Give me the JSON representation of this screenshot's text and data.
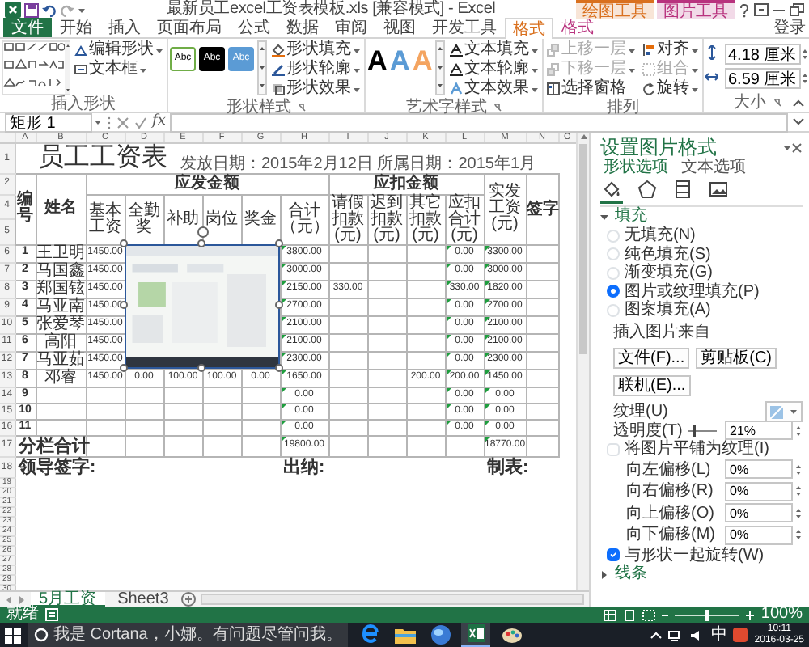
{
  "window": {
    "title": "最新员工excel工资表模板.xls [兼容模式] - Excel",
    "context_groups": [
      {
        "label": "绘图工具",
        "color": "#d9701e"
      },
      {
        "label": "图片工具",
        "color": "#b8327e"
      }
    ],
    "sign_in": "登录"
  },
  "ribbon_tabs": [
    {
      "label": "文件",
      "kind": "file",
      "selected": false
    },
    {
      "label": "开始",
      "kind": "tab",
      "selected": false
    },
    {
      "label": "插入",
      "kind": "tab",
      "selected": false
    },
    {
      "label": "页面布局",
      "kind": "tab",
      "selected": false
    },
    {
      "label": "公式",
      "kind": "tab",
      "selected": false
    },
    {
      "label": "数据",
      "kind": "tab",
      "selected": false
    },
    {
      "label": "审阅",
      "kind": "tab",
      "selected": false
    },
    {
      "label": "视图",
      "kind": "tab",
      "selected": false
    },
    {
      "label": "开发工具",
      "kind": "tab",
      "selected": false
    },
    {
      "label": "格式",
      "kind": "context",
      "color": "#d9701e",
      "selected": true
    },
    {
      "label": "格式",
      "kind": "context",
      "color": "#b8327e",
      "selected": false
    }
  ],
  "ribbon_groups": [
    {
      "label": "插入形状",
      "kind": "shapes",
      "launcher": false,
      "buttons": [
        {
          "label": "编辑形状",
          "disabled": false
        },
        {
          "label": "文本框",
          "disabled": false
        }
      ]
    },
    {
      "label": "形状样式",
      "kind": "styles",
      "launcher": true,
      "swatches": [
        {
          "label": "Abc",
          "color": "#ffffff"
        },
        {
          "label": "Abc",
          "color": "#000000"
        },
        {
          "label": "Abc",
          "color": "#5b9bd5"
        }
      ],
      "buttons": [
        {
          "label": "形状填充",
          "disabled": false
        },
        {
          "label": "形状轮廓",
          "disabled": false
        },
        {
          "label": "形状效果",
          "disabled": false
        }
      ]
    },
    {
      "label": "艺术字样式",
      "kind": "wordart",
      "launcher": true,
      "swatches": [
        {
          "label": "A",
          "color": "#000000"
        },
        {
          "label": "A",
          "color": "#5b9bd5"
        },
        {
          "label": "A",
          "color": "#f4a460"
        }
      ],
      "buttons": [
        {
          "label": "文本填充",
          "disabled": false
        },
        {
          "label": "文本轮廓",
          "disabled": false
        },
        {
          "label": "文本效果",
          "disabled": false
        }
      ]
    },
    {
      "label": "排列",
      "kind": "arrange",
      "launcher": false,
      "buttons": [
        {
          "label": "上移一层",
          "disabled": true
        },
        {
          "label": "下移一层",
          "disabled": true
        },
        {
          "label": "选择窗格",
          "disabled": false
        },
        {
          "label": "对齐",
          "disabled": false
        },
        {
          "label": "组合",
          "disabled": true
        },
        {
          "label": "旋转",
          "disabled": false
        }
      ]
    },
    {
      "label": "大小",
      "kind": "size",
      "launcher": true,
      "fields": [
        {
          "value": "4.18 厘米"
        },
        {
          "value": "6.59 厘米"
        }
      ]
    }
  ],
  "formula_bar": {
    "name_box": "矩形 1",
    "function_label": "fx"
  },
  "sheet": {
    "column_letters": [
      "A",
      "B",
      "C",
      "D",
      "E",
      "F",
      "G",
      "H",
      "I",
      "J",
      "K",
      "L",
      "M",
      "N",
      "O"
    ],
    "title": "员工工资表",
    "date_line": "发放日期：2015年2月12日 所属日期：2015年1月",
    "header_row_numbers": [
      "1",
      "2",
      "4",
      "5"
    ],
    "headers": {
      "number": "编号",
      "name": "姓名",
      "pay_group": "应发金额",
      "pay_columns": [
        "基本工资",
        "全勤奖",
        "补助",
        "岗位",
        "奖金",
        "合计（元）"
      ],
      "deduct_group": "应扣金额",
      "deduct_columns": [
        "请假扣款(元)",
        "迟到扣款(元)",
        "其它扣款(元)",
        "应扣合计(元)"
      ],
      "net": "实发工资(元)",
      "signature": "签字"
    },
    "rows": [
      {
        "row_number": "6",
        "number": "1",
        "name": "王卫明",
        "values": {
          "C": "1450.00",
          "H": "3800.00",
          "L": "0.00",
          "M": "3300.00"
        },
        "flagged": {
          "H": true,
          "L": true,
          "M": true
        }
      },
      {
        "row_number": "7",
        "number": "2",
        "name": "马国鑫",
        "values": {
          "C": "1450.00",
          "H": "3000.00",
          "L": "0.00",
          "M": "3000.00"
        },
        "flagged": {
          "H": true,
          "L": true,
          "M": true
        }
      },
      {
        "row_number": "8",
        "number": "3",
        "name": "郑国铉",
        "values": {
          "C": "1450.00",
          "H": "2150.00",
          "I": "330.00",
          "L": "330.00",
          "M": "1820.00"
        },
        "flagged": {
          "H": true,
          "L": true,
          "M": true
        }
      },
      {
        "row_number": "9",
        "number": "4",
        "name": "马亚南",
        "values": {
          "C": "1450.00",
          "H": "2700.00",
          "L": "0.00",
          "M": "2700.00"
        },
        "flagged": {
          "H": true,
          "L": true,
          "M": true
        }
      },
      {
        "row_number": "10",
        "number": "5",
        "name": "张爱琴",
        "values": {
          "C": "1450.00",
          "H": "2100.00",
          "L": "0.00",
          "M": "2100.00"
        },
        "flagged": {
          "H": true,
          "L": true,
          "M": true
        }
      },
      {
        "row_number": "11",
        "number": "6",
        "name": "高阳",
        "values": {
          "C": "1450.00",
          "H": "2100.00",
          "L": "0.00",
          "M": "2100.00"
        },
        "flagged": {
          "H": true,
          "L": true,
          "M": true
        }
      },
      {
        "row_number": "12",
        "number": "7",
        "name": "马亚茹",
        "values": {
          "C": "1450.00",
          "H": "2300.00",
          "L": "0.00",
          "M": "2300.00"
        },
        "flagged": {
          "H": true,
          "L": true,
          "M": true
        }
      },
      {
        "row_number": "13",
        "number": "8",
        "name": "邓睿",
        "values": {
          "C": "1450.00",
          "D": "0.00",
          "E": "100.00",
          "F": "100.00",
          "G": "0.00",
          "H": "1650.00",
          "K": "200.00",
          "L": "200.00",
          "M": "1450.00"
        },
        "flagged": {
          "H": true,
          "L": true,
          "M": true
        }
      },
      {
        "row_number": "14",
        "number": "9",
        "values": {
          "H": "0.00",
          "L": "0.00",
          "M": "0.00"
        },
        "flagged": {
          "H": true,
          "L": true,
          "M": true
        }
      },
      {
        "row_number": "15",
        "number": "10",
        "values": {
          "H": "0.00",
          "L": "0.00",
          "M": "0.00"
        },
        "flagged": {
          "H": true,
          "L": true,
          "M": true
        }
      },
      {
        "row_number": "16",
        "number": "11",
        "values": {
          "H": "0.00",
          "L": "0.00",
          "M": "0.00"
        },
        "flagged": {
          "H": true,
          "L": true,
          "M": true
        }
      }
    ],
    "total_row": {
      "row_number": "17",
      "label": "分栏合计",
      "values": {
        "H": "19800.00",
        "M": "18770.00"
      },
      "flagged": {
        "H": true,
        "M": true
      }
    },
    "signature_row": {
      "row_number": "18",
      "labels": [
        "领导签字:",
        "出纳:",
        "制表:"
      ]
    },
    "empty_row_numbers": [
      "19",
      "20",
      "21",
      "22",
      "23",
      "24",
      "25",
      "26",
      "27",
      "28",
      "29",
      "30"
    ],
    "picture": {
      "kind": "picture",
      "selected": true
    }
  },
  "format_pane": {
    "title": "设置图片格式",
    "tabs": [
      {
        "label": "形状选项",
        "selected": true
      },
      {
        "label": "文本选项",
        "selected": false
      }
    ],
    "categories": [
      {
        "kind": "fill",
        "selected": true
      },
      {
        "kind": "effects",
        "selected": false
      },
      {
        "kind": "size",
        "selected": false
      },
      {
        "kind": "picture",
        "selected": false
      }
    ],
    "fill": {
      "label": "填充",
      "expanded": true,
      "options": [
        {
          "label": "无填充(N)",
          "selected": false
        },
        {
          "label": "纯色填充(S)",
          "selected": false
        },
        {
          "label": "渐变填充(G)",
          "selected": false
        },
        {
          "label": "图片或纹理填充(P)",
          "selected": true
        },
        {
          "label": "图案填充(A)",
          "selected": false
        }
      ],
      "source_label": "插入图片来自",
      "source_buttons": [
        "文件(F)...",
        "剪贴板(C)",
        "联机(E)..."
      ],
      "texture_label": "纹理(U)",
      "transparency": {
        "label": "透明度(T)",
        "level": 0.21,
        "value": "21%"
      },
      "tile": {
        "label": "将图片平铺为纹理(I)",
        "checked": false
      },
      "offsets": [
        {
          "label": "向左偏移(L)",
          "value": "0%"
        },
        {
          "label": "向右偏移(R)",
          "value": "0%"
        },
        {
          "label": "向上偏移(O)",
          "value": "0%"
        },
        {
          "label": "向下偏移(M)",
          "value": "0%"
        }
      ],
      "rotate": {
        "label": "与形状一起旋转(W)",
        "checked": true
      }
    },
    "line": {
      "label": "线条",
      "expanded": false
    }
  },
  "sheet_tabs": [
    {
      "label": "5月工资",
      "selected": true
    },
    {
      "label": "Sheet3",
      "selected": false
    }
  ],
  "status_bar": {
    "status": "就绪",
    "zoom": "100%",
    "zoom_slider": {
      "level": 0.5
    }
  },
  "taskbar": {
    "search": "我是 Cortana，小娜。有问题尽管问我。",
    "apps": [
      {
        "kind": "browser",
        "active": false
      },
      {
        "kind": "folder",
        "active": false
      },
      {
        "kind": "globe",
        "active": false
      },
      {
        "kind": "spreadsheet",
        "active": true
      },
      {
        "kind": "paint",
        "active": false
      }
    ],
    "ime": "中",
    "time": "10:11",
    "date": "2016-03-25"
  }
}
